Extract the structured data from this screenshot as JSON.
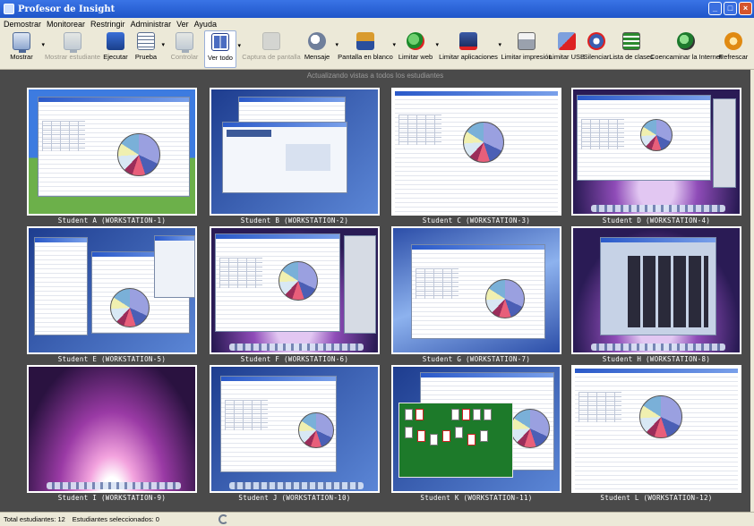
{
  "window": {
    "title": "Profesor de Insight"
  },
  "menu": [
    "Demostrar",
    "Monitorear",
    "Restringir",
    "Administrar",
    "Ver",
    "Ayuda"
  ],
  "toolbar": {
    "mostrar": "Mostrar",
    "mostrar_estudiante": "Mostrar estudiante",
    "ejecutar": "Ejecutar",
    "prueba": "Prueba",
    "controlar": "Controlar",
    "ver_todo": "Ver todo",
    "captura": "Captura de pantalla",
    "mensaje": "Mensaje",
    "pantalla_blanco": "Pantalla en blanco",
    "limitar_web": "Limitar web",
    "limitar_apps": "Limitar aplicaciones",
    "limitar_impresion": "Limitar impresión",
    "limitar_usb": "Limitar USB",
    "silenciar": "Silenciar",
    "lista_clases": "Lista de clases",
    "coencaminar": "Coencaminar la Internet",
    "refrescar": "Refrescar"
  },
  "view": {
    "header": "Actualizando vistas a todos los estudiantes",
    "students": [
      "Student A (WORKSTATION-1)",
      "Student B (WORKSTATION-2)",
      "Student C (WORKSTATION-3)",
      "Student D (WORKSTATION-4)",
      "Student E (WORKSTATION-5)",
      "Student F (WORKSTATION-6)",
      "Student G (WORKSTATION-7)",
      "Student H (WORKSTATION-8)",
      "Student I (WORKSTATION-9)",
      "Student J (WORKSTATION-10)",
      "Student K (WORKSTATION-11)",
      "Student L (WORKSTATION-12)"
    ]
  },
  "status": {
    "total": "Total estudiantes: 12",
    "selected": "Estudiantes seleccionados: 0"
  }
}
